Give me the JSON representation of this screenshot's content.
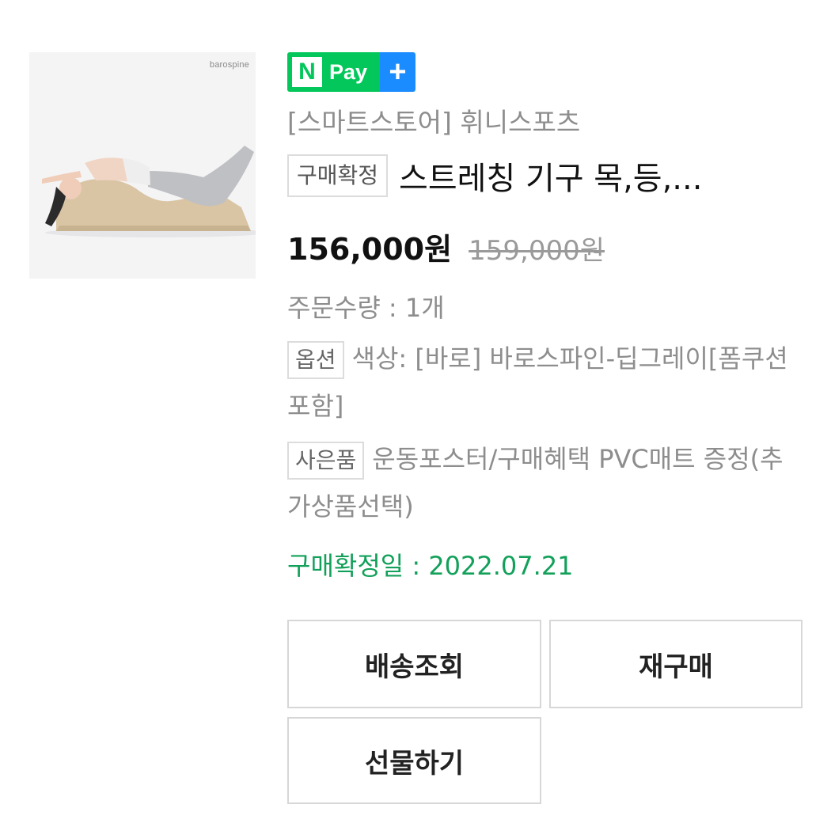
{
  "product": {
    "image_brand": "barospine",
    "npay": {
      "n_label": "N",
      "pay_label": "Pay",
      "plus_label": "+"
    },
    "store": "[스마트스토어] 휘니스포츠",
    "status_tag": "구매확정",
    "title": "스트레칭 기구 목,등,...",
    "price": "156,000원",
    "original_price": "159,000원",
    "quantity": "주문수량 : 1개",
    "option": {
      "tag": "옵션",
      "text": "색상: [바로] 바로스파인-딥그레이[폼쿠션포함]"
    },
    "gift": {
      "tag": "사은품",
      "text": "운동포스터/구매혜택 PVC매트 증정(추가상품선택)"
    },
    "confirm_date": "구매확정일 : 2022.07.21"
  },
  "actions": {
    "track_label": "배송조회",
    "rebuy_label": "재구매",
    "gift_label": "선물하기"
  },
  "colors": {
    "npay_green": "#03c75a",
    "npay_blue": "#1a8cff",
    "confirm_green": "#12a05a"
  }
}
